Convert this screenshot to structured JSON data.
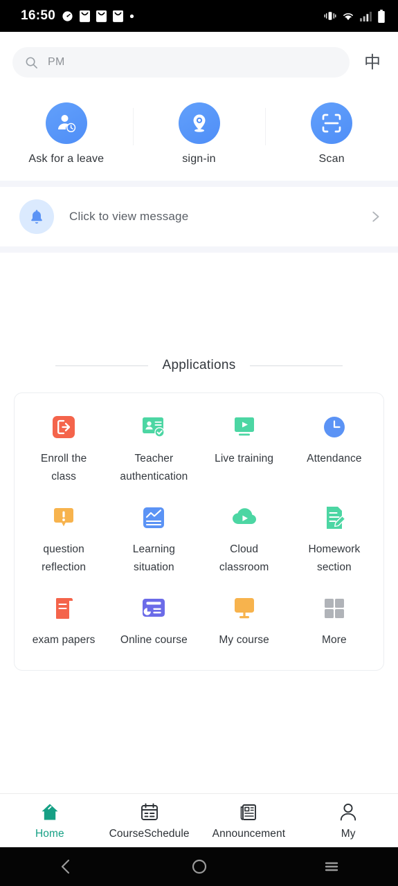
{
  "status_bar": {
    "time": "16:50",
    "left_icons": [
      "speedometer-icon",
      "mail-icon",
      "mail-icon",
      "mail-icon",
      "dot-icon"
    ],
    "right_icons": [
      "vibrate-icon",
      "wifi-icon",
      "signal-icon",
      "battery-icon"
    ]
  },
  "search": {
    "value": "PM",
    "placeholder": "PM",
    "icon": "search-icon",
    "language_toggle": "中"
  },
  "quick_actions": [
    {
      "label": "Ask for a leave",
      "icon": "person-clock-icon"
    },
    {
      "label": "sign-in",
      "icon": "location-pin-icon"
    },
    {
      "label": "Scan",
      "icon": "scan-frame-icon"
    }
  ],
  "message_banner": {
    "icon": "bell-icon",
    "text": "Click to view message",
    "chevron": "chevron-right-icon"
  },
  "applications": {
    "section_title": "Applications",
    "items": [
      {
        "label": "Enroll the\nclass",
        "icon": "enroll-exit-icon",
        "color": "#f4644b"
      },
      {
        "label": "Teacher\nauthentication",
        "icon": "id-card-check-icon",
        "color": "#4cd6a3"
      },
      {
        "label": "Live training",
        "icon": "video-play-icon",
        "color": "#4cd6a3"
      },
      {
        "label": "Attendance",
        "icon": "clock-circle-icon",
        "color": "#5b93f5"
      },
      {
        "label": "question\nreflection",
        "icon": "exclamation-bubble-icon",
        "color": "#f7b34d"
      },
      {
        "label": "Learning\nsituation",
        "icon": "line-chart-icon",
        "color": "#5b93f5"
      },
      {
        "label": "Cloud\nclassroom",
        "icon": "cloud-play-icon",
        "color": "#4cd6a3"
      },
      {
        "label": "Homework\nsection",
        "icon": "document-pencil-icon",
        "color": "#4cd6a3"
      },
      {
        "label": "exam papers",
        "icon": "scroll-paper-icon",
        "color": "#f4644b"
      },
      {
        "label": "Online course",
        "icon": "card-chart-icon",
        "color": "#6b6be8"
      },
      {
        "label": "My course",
        "icon": "monitor-icon",
        "color": "#f7b34d"
      },
      {
        "label": "More",
        "icon": "grid-squares-icon",
        "color": "#b0b3b8"
      }
    ]
  },
  "bottom_tabs": [
    {
      "label": "Home",
      "icon": "home-icon",
      "active": true
    },
    {
      "label": "CourseSchedule",
      "icon": "calendar-icon",
      "active": false
    },
    {
      "label": "Announcement",
      "icon": "newspaper-icon",
      "active": false
    },
    {
      "label": "My",
      "icon": "person-icon",
      "active": false
    }
  ],
  "android_nav": [
    {
      "icon": "back-icon"
    },
    {
      "icon": "home-circle-icon"
    },
    {
      "icon": "recents-icon"
    }
  ],
  "colors": {
    "accent_blue": "#4f8ef7",
    "accent_green": "#16a085",
    "page_bg": "#ffffff",
    "band_bg": "#f4f5fa",
    "search_bg": "#f5f6f8"
  }
}
